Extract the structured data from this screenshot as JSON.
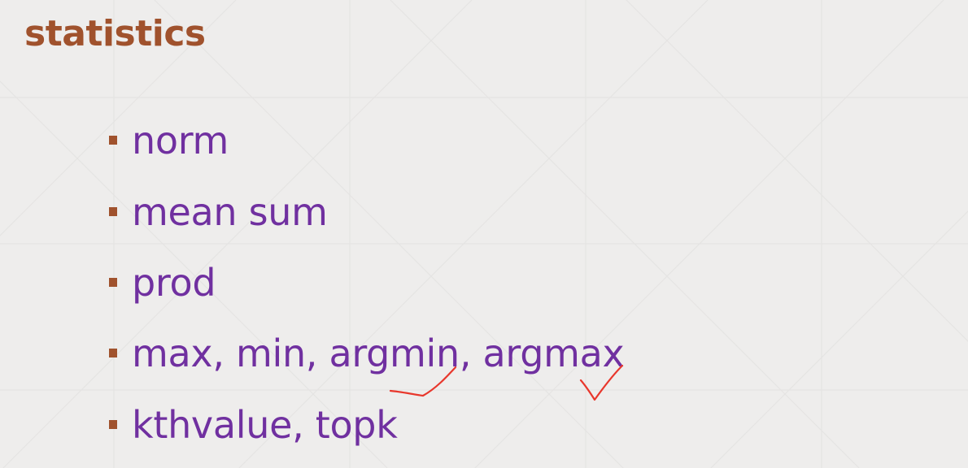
{
  "slide": {
    "title": "statistics",
    "bullets": [
      {
        "label": "norm"
      },
      {
        "label": "mean sum"
      },
      {
        "label": "prod"
      },
      {
        "label": "max, min, argmin, argmax"
      },
      {
        "label": "kthvalue, topk"
      }
    ]
  },
  "colors": {
    "title": "#a0522d",
    "bullet_text": "#7030a0",
    "bullet_marker": "#a0522d",
    "background": "#eeedec",
    "annotation_ink": "#e8372c"
  }
}
